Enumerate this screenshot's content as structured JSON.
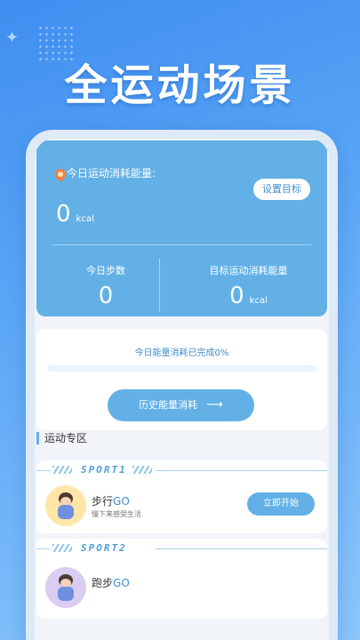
{
  "headline": "全运动场景",
  "energy": {
    "title": "今日运动消耗能量:",
    "set_goal": "设置目标",
    "today_value": "0",
    "unit": "kcal",
    "steps_label": "今日步数",
    "steps_value": "0",
    "target_label": "目标运动消耗能量",
    "target_value": "0",
    "target_unit": "kcal"
  },
  "progress": {
    "text": "今日能量消耗已完成0%",
    "percent": 0,
    "history_button": "历史能量消耗",
    "arrow": "⟶"
  },
  "section": {
    "title": "运动专区"
  },
  "sports": [
    {
      "tag": "SPORT1",
      "name": "步行",
      "go": "GO",
      "desc": "慢下来感受生活",
      "button": "立即开始"
    },
    {
      "tag": "SPORT2",
      "name": "跑步",
      "go": "GO"
    }
  ],
  "icons": {
    "fire": "fire-icon",
    "sparkle": "sparkle-icon"
  },
  "colors": {
    "accent": "#62b0e6",
    "background": "#4a9af3"
  }
}
